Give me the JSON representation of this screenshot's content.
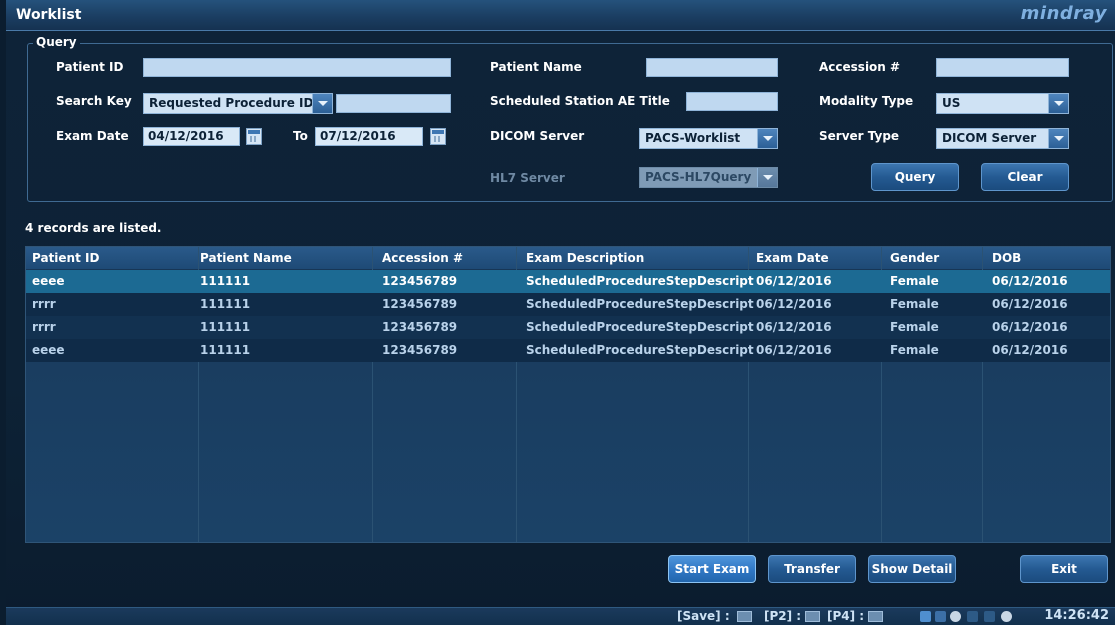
{
  "window": {
    "title": "Worklist",
    "brand": "mindray"
  },
  "query": {
    "legend": "Query",
    "patient_id": {
      "label": "Patient ID",
      "value": ""
    },
    "patient_name": {
      "label": "Patient Name",
      "value": ""
    },
    "accession": {
      "label": "Accession #",
      "value": ""
    },
    "search_key": {
      "label": "Search Key",
      "selected": "Requested Procedure ID",
      "value": ""
    },
    "station_ae": {
      "label": "Scheduled Station AE Title",
      "value": ""
    },
    "modality": {
      "label": "Modality Type",
      "selected": "US"
    },
    "exam_date": {
      "label": "Exam Date",
      "from": "04/12/2016",
      "to_label": "To",
      "to": "07/12/2016"
    },
    "dicom_server": {
      "label": "DICOM Server",
      "selected": "PACS-Worklist"
    },
    "server_type": {
      "label": "Server Type",
      "selected": "DICOM Server"
    },
    "hl7_server": {
      "label": "HL7 Server",
      "selected": "PACS-HL7Query"
    },
    "query_button": "Query",
    "clear_button": "Clear"
  },
  "records_text": "4 records are listed.",
  "table": {
    "columns": [
      "Patient ID",
      "Patient Name",
      "Accession #",
      "Exam Description",
      "Exam Date",
      "Gender",
      "DOB"
    ],
    "rows": [
      [
        "eeee",
        "111111",
        "123456789",
        "ScheduledProcedureStepDescript...",
        "06/12/2016",
        "Female",
        "06/12/2016"
      ],
      [
        "rrrr",
        "111111",
        "123456789",
        "ScheduledProcedureStepDescript...",
        "06/12/2016",
        "Female",
        "06/12/2016"
      ],
      [
        "rrrr",
        "111111",
        "123456789",
        "ScheduledProcedureStepDescript...",
        "06/12/2016",
        "Female",
        "06/12/2016"
      ],
      [
        "eeee",
        "111111",
        "123456789",
        "ScheduledProcedureStepDescript...",
        "06/12/2016",
        "Female",
        "06/12/2016"
      ]
    ],
    "selected_row": 0
  },
  "actions": {
    "start_exam": "Start Exam",
    "transfer": "Transfer",
    "show_detail": "Show Detail",
    "exit": "Exit"
  },
  "statusbar": {
    "save": "[Save] :",
    "p2": "[P2] :",
    "p4": "[P4] :",
    "time": "14:26:42"
  },
  "colors": {
    "selected_row": "#1c6a93",
    "accent": "#2f77c4",
    "brand": "#7fb0e0"
  }
}
